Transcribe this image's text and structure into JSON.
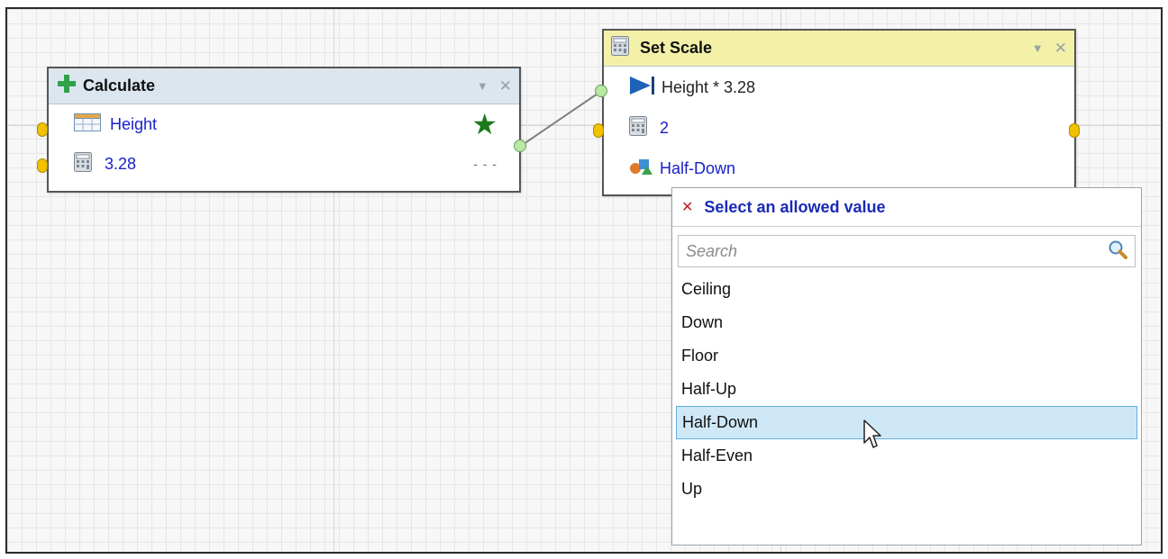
{
  "calculate_node": {
    "title": "Calculate",
    "rows": [
      {
        "label": "Height",
        "icon": "table-grid-icon"
      },
      {
        "label": "3.28",
        "icon": "calculator-icon"
      }
    ],
    "required_marker": "★",
    "more_marker": "- - -"
  },
  "set_scale_node": {
    "title": "Set Scale",
    "rows": [
      {
        "label": "Height * 3.28",
        "icon": "play-to-end-icon"
      },
      {
        "label": "2",
        "icon": "calculator-icon"
      },
      {
        "label": "Half-Down",
        "icon": "shapes-icon"
      }
    ]
  },
  "dropdown": {
    "title": "Select an allowed value",
    "search_placeholder": "Search",
    "options": [
      "Ceiling",
      "Down",
      "Floor",
      "Half-Up",
      "Half-Down",
      "Half-Even",
      "Up"
    ],
    "selected": "Half-Down"
  },
  "colors": {
    "calculate_header": "#dbe6ef",
    "set_scale_header": "#f3f1a8",
    "link_blue": "#1a20c8",
    "highlight": "#cfe8f7"
  }
}
